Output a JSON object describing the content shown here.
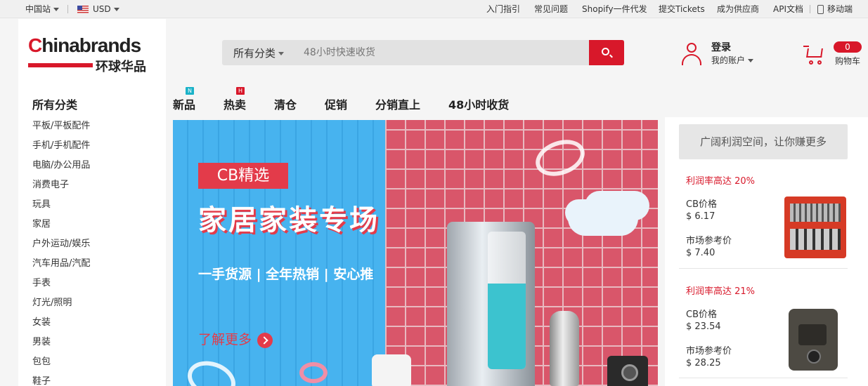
{
  "topbar": {
    "site": "中国站",
    "currency": "USD",
    "links": [
      "入门指引",
      "常见问题",
      "Shopify一件代发",
      "提交Tickets",
      "成为供应商",
      "API文档"
    ],
    "mobile": "移动端"
  },
  "logo": {
    "brand_c": "C",
    "brand_rest": "hinabrands",
    "cn": "环球华品"
  },
  "search": {
    "category": "所有分类",
    "placeholder": "48小时快速收货"
  },
  "account": {
    "login": "登录",
    "my_account": "我的账户"
  },
  "cart": {
    "count": "0",
    "label": "购物车"
  },
  "sidebar": {
    "title": "所有分类",
    "items": [
      "平板/平板配件",
      "手机/手机配件",
      "电脑/办公用品",
      "消费电子",
      "玩具",
      "家居",
      "户外运动/娱乐",
      "汽车用品/汽配",
      "手表",
      "灯光/照明",
      "女装",
      "男装",
      "包包",
      "鞋子"
    ]
  },
  "nav": {
    "items": [
      "新品",
      "热卖",
      "清仓",
      "促销",
      "分销直上",
      "48小时收货"
    ],
    "badges": {
      "new": "N",
      "hot": "H"
    },
    "badge_colors": {
      "new": "#1ab2c8",
      "hot": "#d8182a"
    }
  },
  "banner": {
    "tag": "CB精选",
    "title": "家居家装专场",
    "subtitle": "一手货源 | 全年热销 | 安心推",
    "more": "了解更多"
  },
  "profit_panel": {
    "header": "广阔利润空间，让你赚更多",
    "products": [
      {
        "profit": "利润率高达 20%",
        "cb_label": "CB价格",
        "cb_price": "$ 6.17",
        "market_label": "市场参考价",
        "market_price": "$ 7.40"
      },
      {
        "profit": "利润率高达 21%",
        "cb_label": "CB价格",
        "cb_price": "$ 23.54",
        "market_label": "市场参考价",
        "market_price": "$ 28.25"
      }
    ]
  },
  "colors": {
    "brand_red": "#d8182a",
    "banner_blue": "#47b3ef",
    "banner_pink": "#d9566a"
  }
}
